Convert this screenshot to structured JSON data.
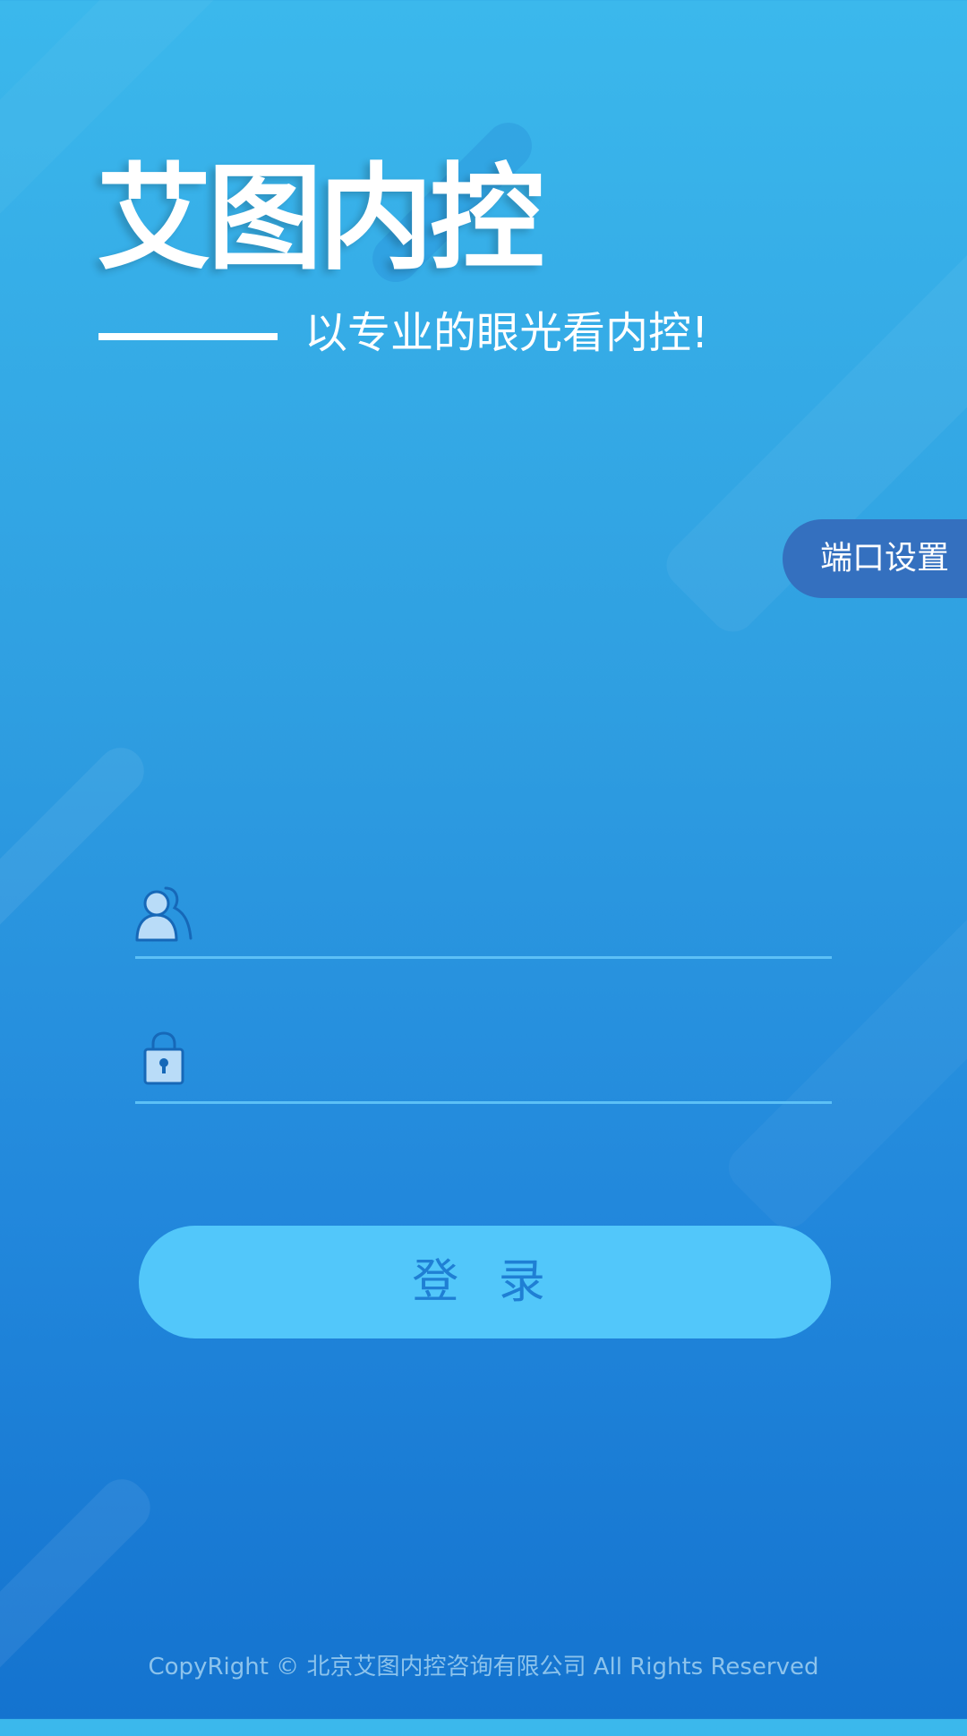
{
  "header": {
    "app_title": "艾图内控",
    "slogan": "以专业的眼光看内控!"
  },
  "port_settings": {
    "label": "端口设置"
  },
  "login_form": {
    "username_placeholder": "",
    "password_placeholder": "",
    "submit_label": "登 录"
  },
  "icons": {
    "username": "user-icon",
    "password": "lock-icon"
  },
  "colors": {
    "background_top": "#3bb8ec",
    "background_bottom": "#1473cf",
    "port_button": "#3470bf",
    "login_button": "#52c7fa",
    "login_text": "#1f7fd4",
    "underline": "#5cc0f6",
    "footer_text": "#8cc3ec"
  },
  "footer": {
    "copyright": "CopyRight © 北京艾图内控咨询有限公司 All Rights Reserved"
  }
}
